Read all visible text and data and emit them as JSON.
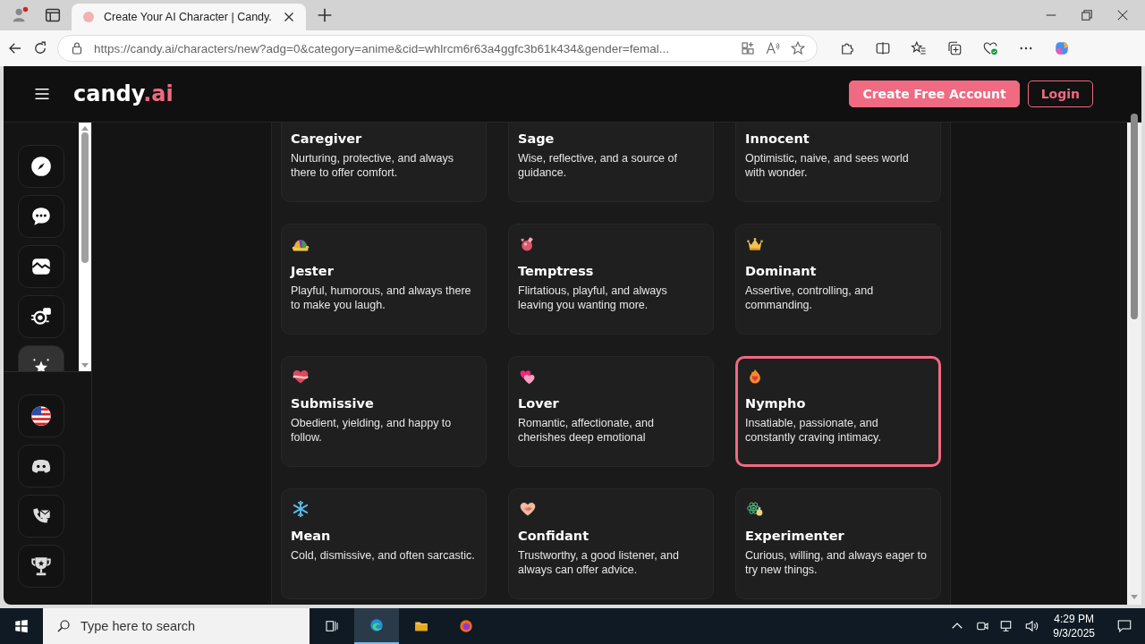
{
  "browser": {
    "tab_title": "Create Your AI Character | Candy.",
    "url": "https://candy.ai/characters/new?adg=0&category=anime&cid=whlrcm6r63a4ggfc3b61k434&gender=femal..."
  },
  "header": {
    "logo_name": "candy",
    "logo_suffix": ".ai",
    "buttons": [
      {
        "label": "Create Free Account",
        "kind": "primary"
      },
      {
        "label": "Login",
        "kind": "outline"
      }
    ]
  },
  "nav_items": [
    {
      "selected": false
    },
    {
      "selected": false
    },
    {
      "selected": false
    },
    {
      "selected": false
    },
    {
      "selected": true
    }
  ],
  "footer_items": [
    {
      "selected": false
    },
    {
      "selected": false
    },
    {
      "selected": false
    },
    {
      "selected": false
    }
  ],
  "cards": [
    {
      "title": "Caregiver",
      "description": "Nurturing, protective, and always there to offer comfort.",
      "selected": false
    },
    {
      "title": "Sage",
      "description": "Wise, reflective, and a source of guidance.",
      "selected": false
    },
    {
      "title": "Innocent",
      "description": "Optimistic, naive, and sees world with wonder.",
      "selected": false
    },
    {
      "title": "Jester",
      "description": "Playful, humorous, and always there to make you laugh.",
      "selected": false
    },
    {
      "title": "Temptress",
      "description": "Flirtatious, playful, and always leaving you wanting more.",
      "selected": false
    },
    {
      "title": "Dominant",
      "description": "Assertive, controlling, and commanding.",
      "selected": false
    },
    {
      "title": "Submissive",
      "description": "Obedient, yielding, and happy to follow.",
      "selected": false
    },
    {
      "title": "Lover",
      "description": "Romantic, affectionate, and cherishes deep emotional",
      "selected": false
    },
    {
      "title": "Nympho",
      "description": "Insatiable, passionate, and constantly craving intimacy.",
      "selected": true
    },
    {
      "title": "Mean",
      "description": "Cold, dismissive, and often sarcastic.",
      "selected": false
    },
    {
      "title": "Confidant",
      "description": "Trustworthy, a good listener, and always can offer advice.",
      "selected": false
    },
    {
      "title": "Experimenter",
      "description": "Curious, willing, and always eager to try new things.",
      "selected": false
    }
  ],
  "taskbar": {
    "search_placeholder": "Type here to search",
    "time": "4:29 PM",
    "date": "9/3/2025"
  }
}
